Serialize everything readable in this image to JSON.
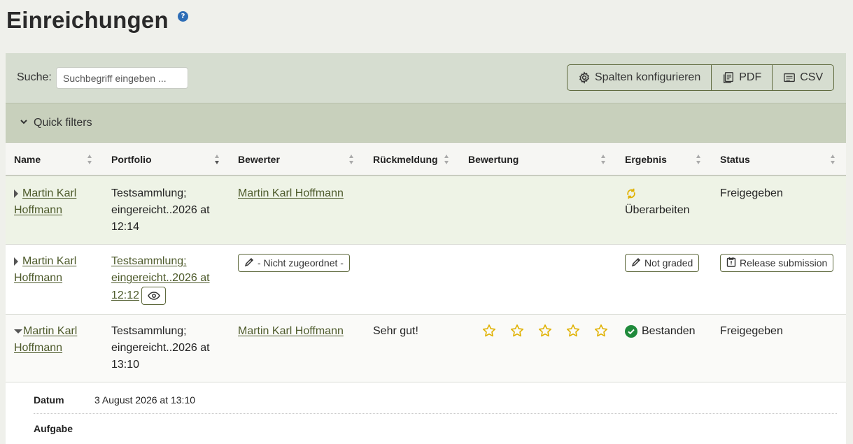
{
  "page": {
    "title": "Einreichungen",
    "help": "?"
  },
  "toolbar": {
    "search_label": "Suche:",
    "search_placeholder": "Suchbegriff eingeben ...",
    "configure_label": "Spalten konfigurieren",
    "pdf_label": "PDF",
    "csv_label": "CSV"
  },
  "quick_filters": {
    "label": "Quick filters"
  },
  "table": {
    "columns": [
      "Name",
      "Portfolio",
      "Bewerter",
      "Rückmeldung",
      "Bewertung",
      "Ergebnis",
      "Status"
    ],
    "rows": [
      {
        "name": "Martin Karl Hoffmann",
        "portfolio": "Testsammlung; eingereicht..2026 at 12:14",
        "grader": "Martin Karl Hoffmann",
        "feedback": "",
        "result": "Überarbeiten",
        "status": "Freigegeben"
      },
      {
        "name": "Martin Karl Hoffmann",
        "portfolio": "Testsammlung; eingereicht..2026 at 12:12",
        "grader_button": "- Nicht zugeordnet -",
        "feedback": "",
        "result_button": "Not graded",
        "status_button": "Release submission"
      },
      {
        "name": "Martin Karl Hoffmann",
        "portfolio": "Testsammlung; eingereicht..2026 at 13:10",
        "grader": "Martin Karl Hoffmann",
        "feedback": "Sehr gut!",
        "rating_stars": 5,
        "result": "Bestanden",
        "status": "Freigegeben"
      }
    ]
  },
  "details": {
    "date_label": "Datum",
    "date_value": "3 August 2026 at 13:10",
    "task_label": "Aufgabe"
  },
  "colors": {
    "accent": "#4d5a2b",
    "toolbar_bg": "#d6ddd0",
    "quick_filters_bg": "#c8d0bc",
    "row_highlight": "#eef3e6",
    "star": "#e0b100",
    "success": "#1f8a3b",
    "help": "#2d6db6"
  }
}
